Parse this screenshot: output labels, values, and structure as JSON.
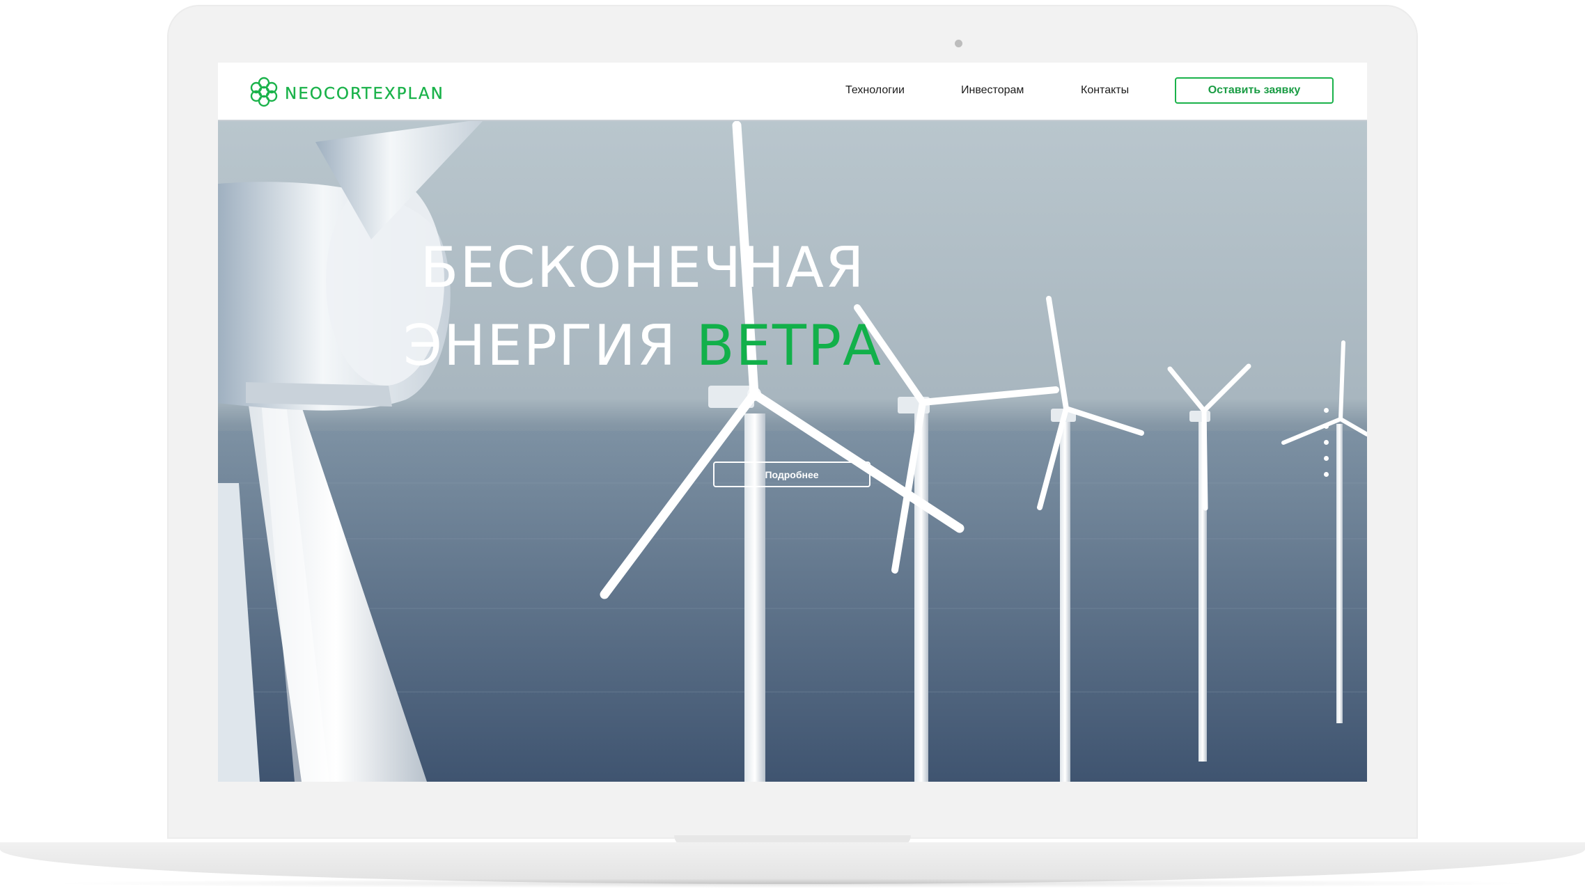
{
  "brand": {
    "name": "NEOCORTEXPLAN",
    "accent_color": "#1ab24a"
  },
  "nav": {
    "items": [
      {
        "label": "Технологии"
      },
      {
        "label": "Инвесторам"
      },
      {
        "label": "Контакты"
      }
    ],
    "cta_label": "Оставить заявку"
  },
  "hero": {
    "headline_line1": "БЕСКОНЕЧНАЯ",
    "headline_line2_white": "ЭНЕРГИЯ",
    "headline_line2_accent": "ВЕТРА",
    "button_label": "Подробнее",
    "slider_dots": 5,
    "background": "offshore-wind-turbines-photo"
  }
}
